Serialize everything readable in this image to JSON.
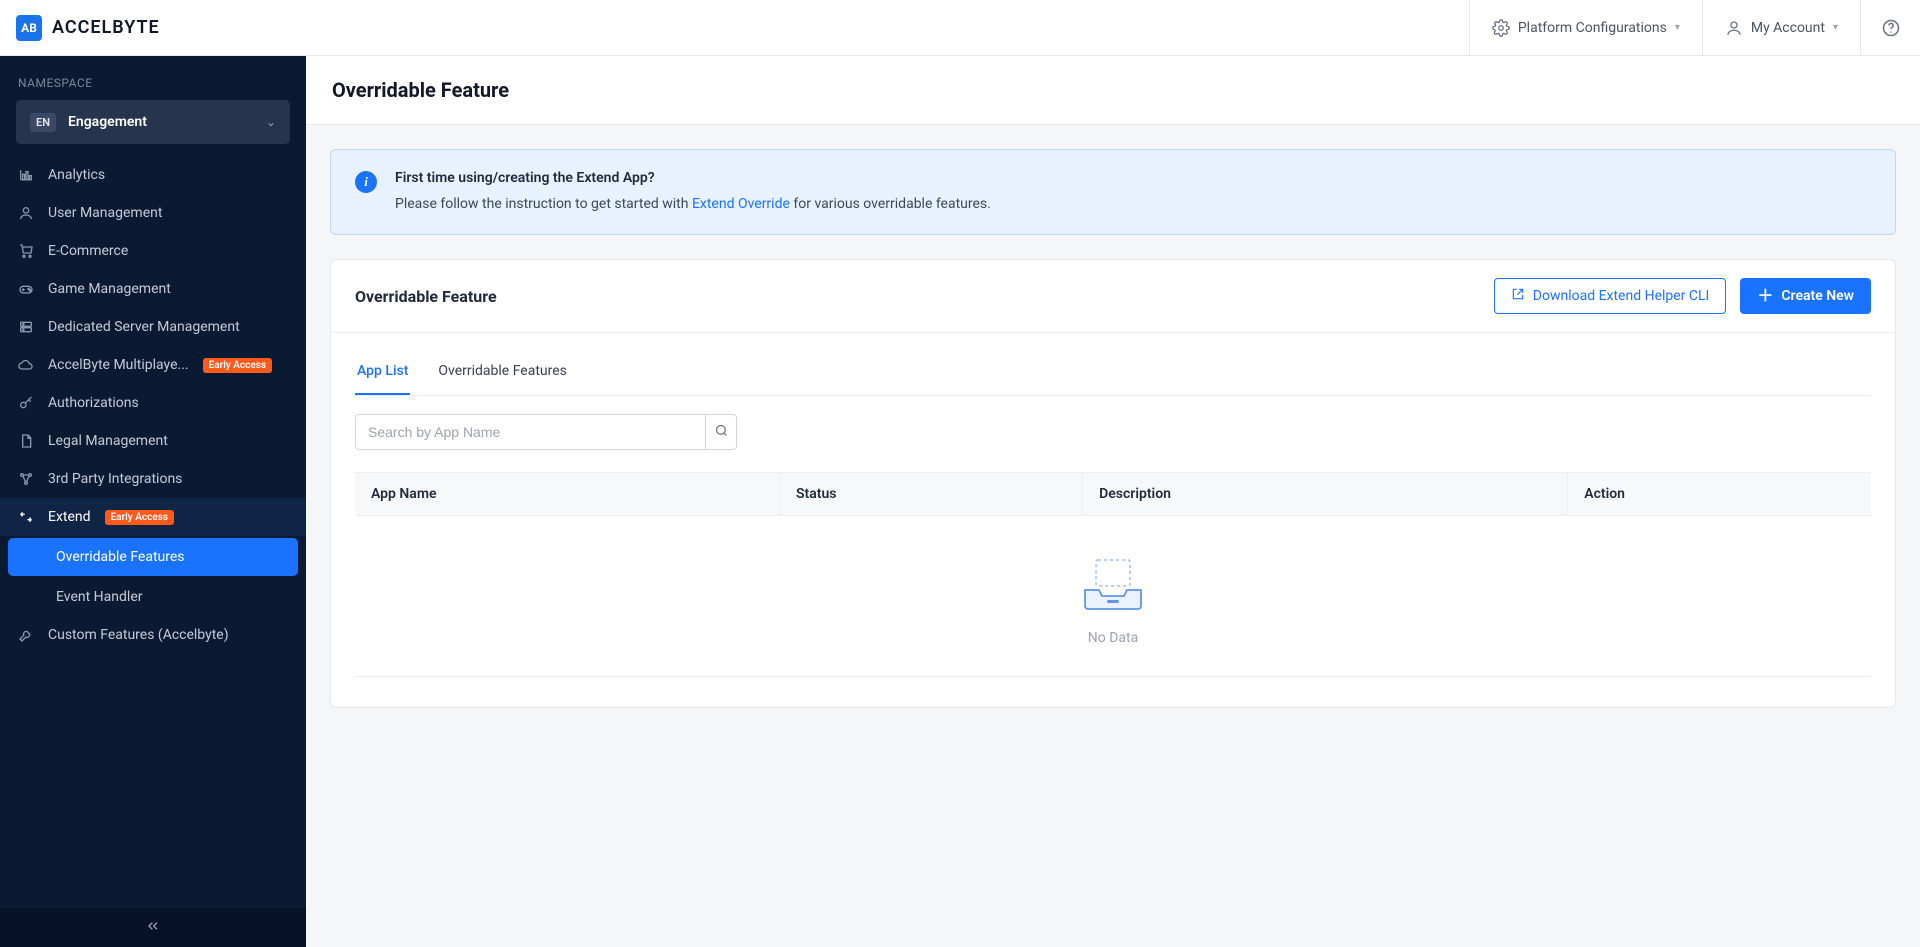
{
  "brand": {
    "icon_initials": "AB",
    "name": "ACCELBYTE"
  },
  "header": {
    "platform_configs": "Platform Configurations",
    "my_account": "My Account"
  },
  "sidebar": {
    "namespace_label": "NAMESPACE",
    "namespace": {
      "badge": "EN",
      "name": "Engagement"
    },
    "items": [
      {
        "label": "Analytics"
      },
      {
        "label": "User Management"
      },
      {
        "label": "E-Commerce"
      },
      {
        "label": "Game Management"
      },
      {
        "label": "Dedicated Server Management"
      },
      {
        "label": "AccelByte Multiplaye...",
        "early_access": true
      },
      {
        "label": "Authorizations"
      },
      {
        "label": "Legal Management"
      },
      {
        "label": "3rd Party Integrations"
      },
      {
        "label": "Extend",
        "early_access": true,
        "expanded": true,
        "sub": [
          {
            "label": "Overridable Features",
            "active": true
          },
          {
            "label": "Event Handler"
          }
        ]
      },
      {
        "label": "Custom Features (Accelbyte)"
      }
    ],
    "early_access_tag": "Early Access"
  },
  "page": {
    "title": "Overridable Feature",
    "banner": {
      "title": "First time using/creating the Extend App?",
      "text_before": "Please follow the instruction to get started with ",
      "link": "Extend Override",
      "text_after": " for various overridable features."
    },
    "card": {
      "title": "Overridable Feature",
      "download_cli": "Download Extend Helper CLI",
      "create_new": "Create New",
      "tabs": {
        "app_list": "App List",
        "overridable_features": "Overridable Features"
      },
      "search_placeholder": "Search by App Name",
      "columns": {
        "app_name": "App Name",
        "status": "Status",
        "description": "Description",
        "action": "Action"
      },
      "no_data": "No Data"
    }
  }
}
